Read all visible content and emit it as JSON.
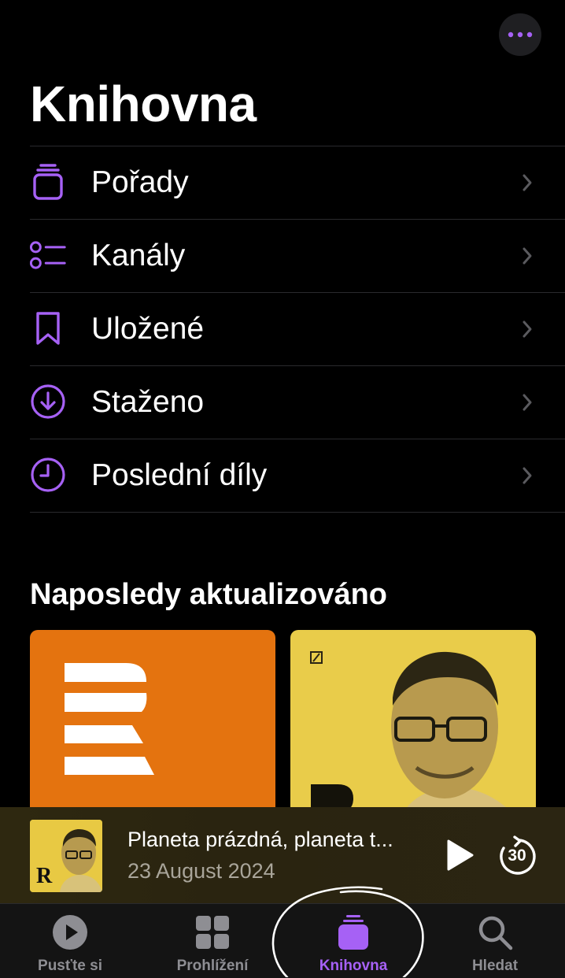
{
  "header": {
    "title": "Knihovna",
    "more_icon": "ellipsis-icon"
  },
  "menu": {
    "items": [
      {
        "label": "Pořady",
        "icon": "stack-icon"
      },
      {
        "label": "Kanály",
        "icon": "channels-list-icon"
      },
      {
        "label": "Uložené",
        "icon": "bookmark-icon"
      },
      {
        "label": "Staženo",
        "icon": "download-icon"
      },
      {
        "label": "Poslední díly",
        "icon": "clock-icon"
      }
    ]
  },
  "recent": {
    "title": "Naposledy aktualizováno",
    "tiles": [
      {
        "name": "rozhlas-artwork",
        "color": "#e4730f"
      },
      {
        "name": "rozhovory-artwork",
        "color": "#e9cc4a"
      }
    ]
  },
  "player": {
    "title": "Planeta prázdná, planeta t...",
    "date": "23 August 2024",
    "skip_seconds": "30",
    "art_mark": "R"
  },
  "tabs": [
    {
      "label": "Pusťte si",
      "icon": "play-circle-icon",
      "active": false
    },
    {
      "label": "Prohlížení",
      "icon": "grid-icon",
      "active": false
    },
    {
      "label": "Knihovna",
      "icon": "library-stack-icon",
      "active": true
    },
    {
      "label": "Hledat",
      "icon": "search-icon",
      "active": false
    }
  ],
  "colors": {
    "accent": "#a661f5",
    "background": "#000000",
    "inactive_tab": "#8e8e93",
    "separator": "#2a2a2d"
  }
}
